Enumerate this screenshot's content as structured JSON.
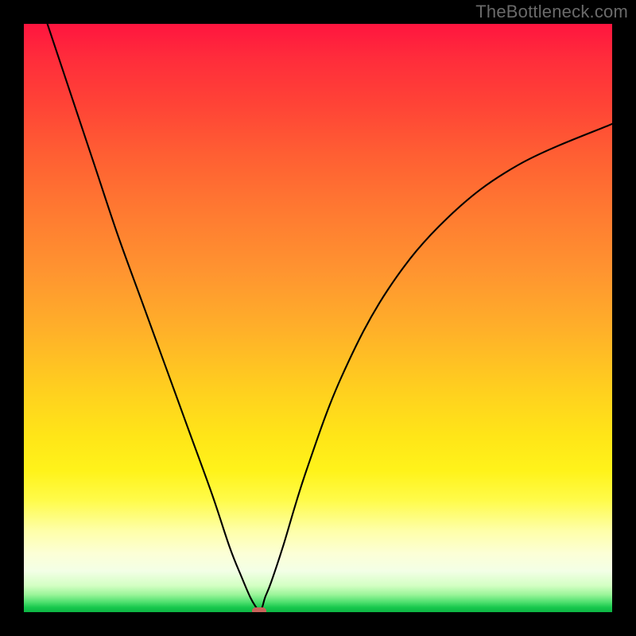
{
  "watermark": "TheBottleneck.com",
  "chart_data": {
    "type": "line",
    "title": "",
    "xlabel": "",
    "ylabel": "",
    "xlim": [
      0,
      100
    ],
    "ylim": [
      0,
      100
    ],
    "grid": false,
    "legend": false,
    "notes": "Background is a vertical spectral gradient (red → green). Single black V-shaped curve; minimum marked by small rounded reddish pill near y=0.",
    "series": [
      {
        "name": "curve",
        "x": [
          4,
          8,
          12,
          16,
          20,
          24,
          28,
          32,
          35,
          37,
          38.5,
          39.5,
          40,
          40.5,
          41,
          42,
          44,
          48,
          54,
          62,
          72,
          84,
          100
        ],
        "y": [
          100,
          88,
          76,
          64,
          53,
          42,
          31,
          20,
          11,
          6,
          2.5,
          0.8,
          0.2,
          0.8,
          2.5,
          5,
          11,
          24,
          40,
          55,
          67,
          76,
          83
        ]
      }
    ],
    "marker": {
      "x": 40,
      "y": 0.2,
      "shape": "pill",
      "color": "#c9635a"
    },
    "gradient_stops": [
      {
        "pct": 0,
        "color": "#ff153f"
      },
      {
        "pct": 14,
        "color": "#ff4436"
      },
      {
        "pct": 32,
        "color": "#ff7a31"
      },
      {
        "pct": 52,
        "color": "#ffb029"
      },
      {
        "pct": 70,
        "color": "#ffe518"
      },
      {
        "pct": 86,
        "color": "#feffa6"
      },
      {
        "pct": 97,
        "color": "#9cf59a"
      },
      {
        "pct": 100,
        "color": "#0db544"
      }
    ]
  }
}
